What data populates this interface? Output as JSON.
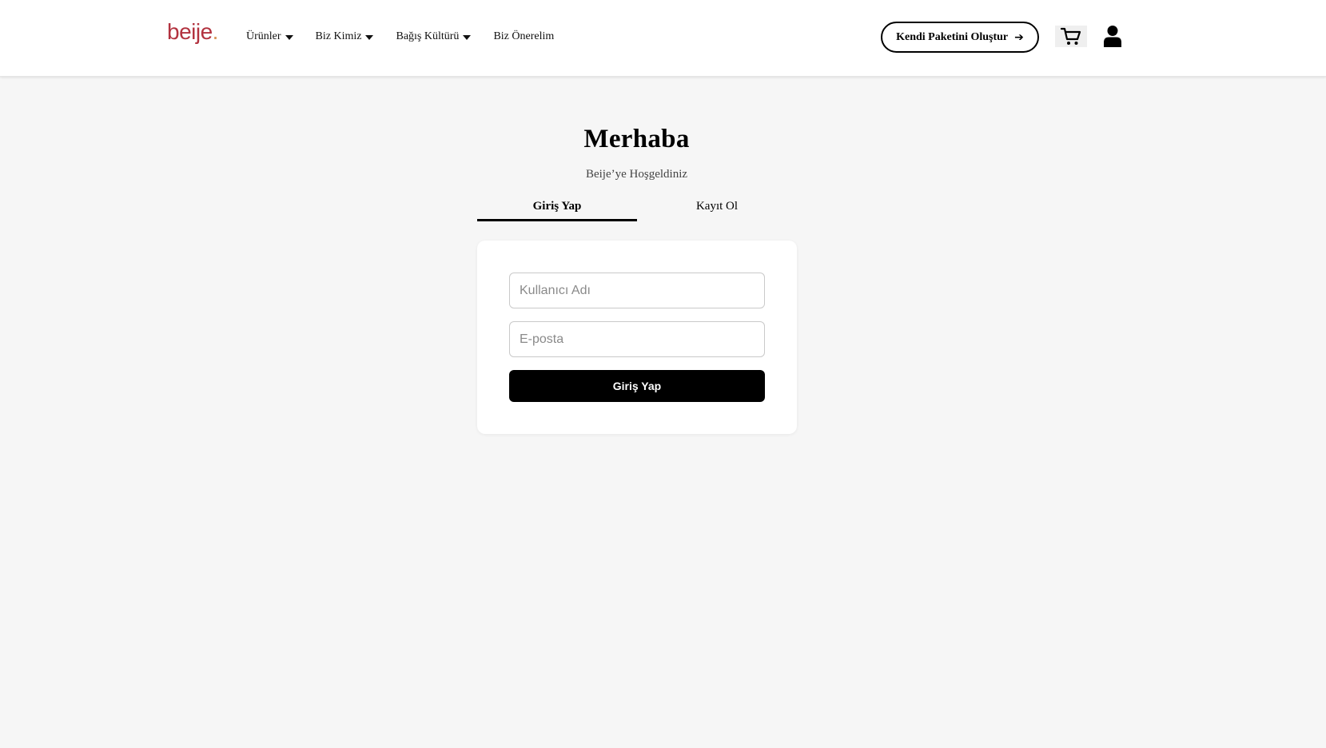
{
  "header": {
    "logo": {
      "text": "beije",
      "dot": "."
    },
    "nav": [
      {
        "label": "Ürünler",
        "has_dropdown": true
      },
      {
        "label": "Biz Kimiz",
        "has_dropdown": true
      },
      {
        "label": "Bağış Kültürü",
        "has_dropdown": true
      },
      {
        "label": "Biz Önerelim",
        "has_dropdown": false
      }
    ],
    "cta_label": "Kendi Paketini Oluştur",
    "cta_icon": "arrow-right-icon",
    "cart_icon": "shopping-cart-icon",
    "user_icon": "user-icon"
  },
  "main": {
    "title": "Merhaba",
    "subtitle": "Beije’ye Hoşgeldiniz",
    "tabs": [
      {
        "label": "Giriş Yap",
        "active": true
      },
      {
        "label": "Kayıt Ol",
        "active": false
      }
    ],
    "form": {
      "username": {
        "placeholder": "Kullanıcı Adı",
        "value": ""
      },
      "email": {
        "placeholder": "E-posta",
        "value": ""
      },
      "submit_label": "Giriş Yap"
    }
  },
  "colors": {
    "logo_text": "#b2323f",
    "logo_dot": "#d8965a",
    "background": "#f6f6f6",
    "primary_button": "#000000"
  }
}
